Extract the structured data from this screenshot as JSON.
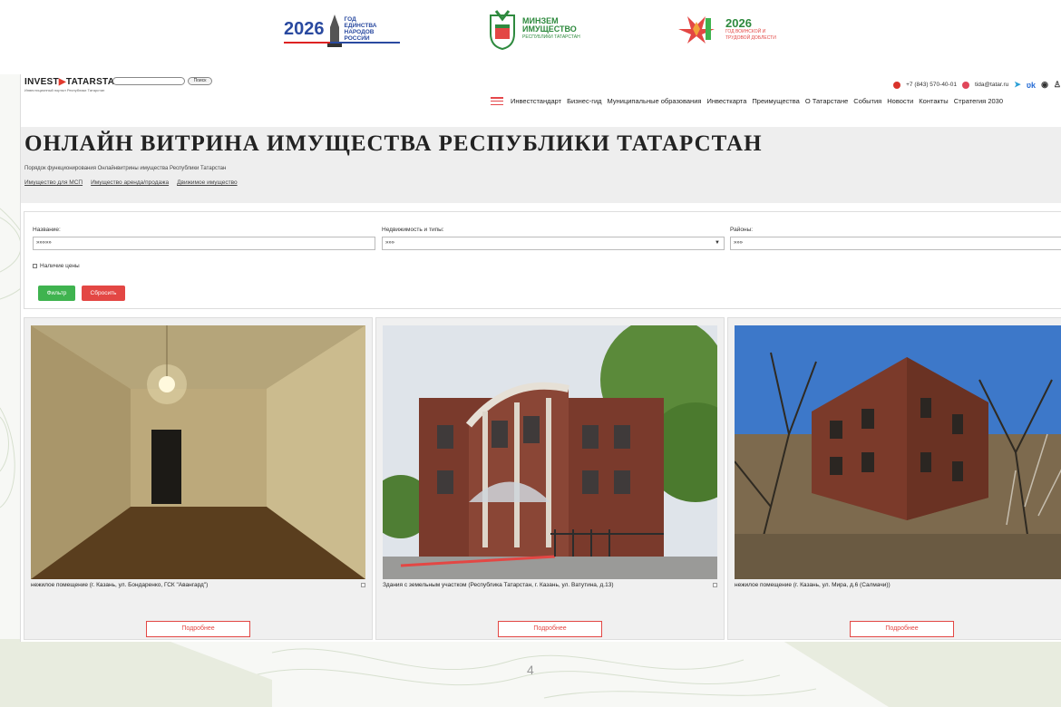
{
  "logos": {
    "year_unity": {
      "year": "2026",
      "text": "ГОД ЕДИНСТВА НАРОДОВ РОССИИ"
    },
    "ministry": {
      "line1": "МИНЗЕМ",
      "line2": "ИМУЩЕСТВО",
      "line3": "РЕСПУБЛИКИ ТАТАРСТАН"
    },
    "year_labor": {
      "year": "2026",
      "text": "ГОД ВОИНСКОЙ И ТРУДОВОЙ ДОБЛЕСТИ"
    }
  },
  "site": {
    "brand_left": "INVEST",
    "brand_right": "TATARSTAN",
    "brand_sub": "Инвестиционный портал Республики Татарстан",
    "search_button": "Поиск",
    "phone": "+7 (843) 570-40-01",
    "email": "tida@tatar.ru"
  },
  "menu": [
    "Инвестстандарт",
    "Бизнес-гид",
    "Муниципальные образования",
    "Инвесткарта",
    "Преимущества",
    "О Татарстане",
    "События",
    "Новости",
    "Контакты",
    "Стратегия 2030"
  ],
  "page": {
    "title": "ОНЛАЙН ВИТРИНА ИМУЩЕСТВА РЕСПУБЛИКИ ТАТАРСТАН",
    "sublink": "Порядок функционирования Онлайнвитрины имущества Республики Татарстан",
    "tabs": [
      "Имущество для МСП",
      "Имущество аренда/продажа",
      "Движимое имущество"
    ]
  },
  "filter": {
    "name_label": "Название:",
    "name_value": "»»»»»",
    "type_label": "Недвижимость и типы:",
    "type_value": "»»»",
    "district_label": "Районы:",
    "district_value": "»»»",
    "price_checkbox": "Наличие цены",
    "apply_button": "Фильтр",
    "reset_button": "Сбросить"
  },
  "cards": [
    {
      "caption": "нежилое помещение (г. Казань, ул. Бондаренко, ГСК \"Авангард\")",
      "button": "Подробнее"
    },
    {
      "caption": "Здания с земельным участком (Республика Татарстан, г. Казань, ул. Ватутина, д.13)",
      "button": "Подробнее"
    },
    {
      "caption": "нежилое помещение (г. Казань, ул. Мира, д.6 (Салмачи))",
      "button": "Подробнее"
    }
  ],
  "page_number": "4",
  "colors": {
    "accent_red": "#e34744",
    "accent_green": "#3fb34f",
    "brand_green": "#2e8a3e"
  }
}
